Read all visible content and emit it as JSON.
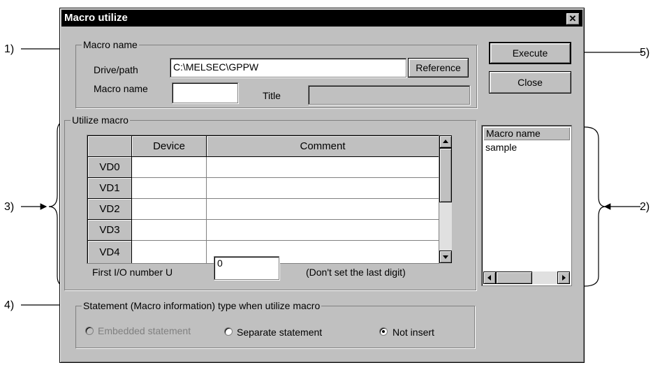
{
  "window": {
    "title": "Macro utilize",
    "close_glyph": "✕"
  },
  "macro_name_group": {
    "legend": "Macro name",
    "drive_path_label": "Drive/path",
    "drive_path_value": "C:\\MELSEC\\GPPW",
    "reference_button": "Reference",
    "macro_name_label": "Macro name",
    "macro_name_value": "",
    "title_label": "Title",
    "title_value": ""
  },
  "buttons": {
    "execute": "Execute",
    "close": "Close"
  },
  "utilize_group": {
    "legend": "Utilize macro",
    "columns": [
      "",
      "Device",
      "Comment"
    ],
    "rows": [
      {
        "label": "VD0",
        "device": "",
        "comment": ""
      },
      {
        "label": "VD1",
        "device": "",
        "comment": ""
      },
      {
        "label": "VD2",
        "device": "",
        "comment": ""
      },
      {
        "label": "VD3",
        "device": "",
        "comment": ""
      },
      {
        "label": "VD4",
        "device": "",
        "comment": ""
      }
    ],
    "first_io_label": "First I/O number U",
    "first_io_value": "0",
    "first_io_note": "(Don't set the last digit)"
  },
  "macro_list": {
    "header": "Macro name",
    "items": [
      "sample"
    ]
  },
  "statement_group": {
    "legend": "Statement (Macro information) type when utilize macro",
    "options": [
      {
        "label": "Embedded statement",
        "enabled": false,
        "selected": false
      },
      {
        "label": "Separate statement",
        "enabled": true,
        "selected": false
      },
      {
        "label": "Not insert",
        "enabled": true,
        "selected": true
      }
    ]
  },
  "callouts": {
    "c1": "1)",
    "c2": "2)",
    "c3": "3)",
    "c4": "4)",
    "c5": "5)"
  },
  "colors": {
    "dialog_bg": "#c0c0c0",
    "titlebar_bg": "#000000",
    "disabled_text": "#808080"
  }
}
